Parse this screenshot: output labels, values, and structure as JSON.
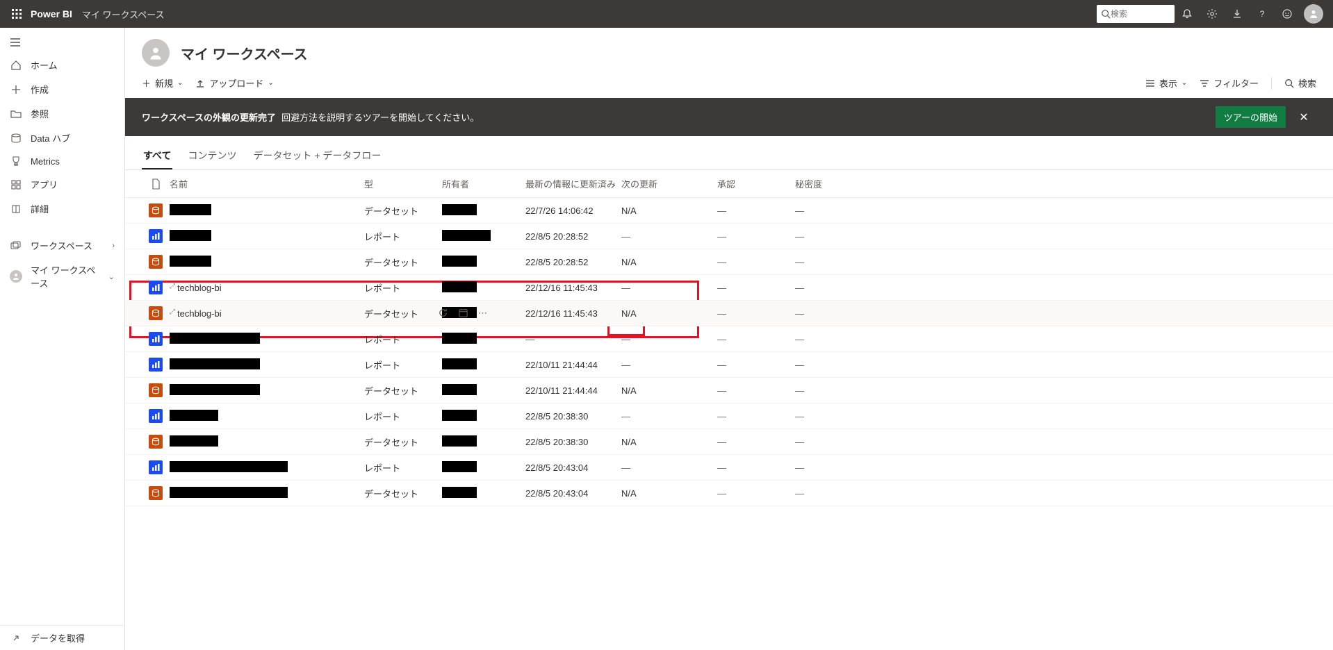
{
  "topbar": {
    "brand": "Power BI",
    "breadcrumb": "マイ ワークスペース",
    "search_placeholder": "検索"
  },
  "sidebar": {
    "home": "ホーム",
    "create": "作成",
    "browse": "参照",
    "datahub": "Data ハブ",
    "metrics": "Metrics",
    "apps": "アプリ",
    "detail": "詳細",
    "workspaces": "ワークスペース",
    "myworkspace": "マイ ワークスペース",
    "getdata": "データを取得"
  },
  "page": {
    "title": "マイ ワークスペース"
  },
  "cmdbar": {
    "new": "新規",
    "upload": "アップロード",
    "view": "表示",
    "filter": "フィルター",
    "search": "検索"
  },
  "banner": {
    "bold": "ワークスペースの外観の更新完了",
    "text": "回避方法を説明するツアーを開始してください。",
    "tour": "ツアーの開始"
  },
  "tabs": {
    "all": "すべて",
    "content": "コンテンツ",
    "dsflow": "データセット + データフロー"
  },
  "cols": {
    "name": "名前",
    "type": "型",
    "owner": "所有者",
    "refreshed": "最新の情報に更新済み",
    "next": "次の更新",
    "approve": "承認",
    "sens": "秘密度"
  },
  "rows": [
    {
      "icon": "dataset",
      "name_redact": 60,
      "type": "データセット",
      "owner_redact": 50,
      "refreshed": "22/7/26 14:06:42",
      "next": "N/A",
      "approve": "—",
      "sens": "—"
    },
    {
      "icon": "report",
      "name_redact": 60,
      "type": "レポート",
      "owner_redact": 70,
      "refreshed": "22/8/5 20:28:52",
      "next": "—",
      "approve": "—",
      "sens": "—"
    },
    {
      "icon": "dataset",
      "name_redact": 60,
      "type": "データセット",
      "owner_redact": 50,
      "refreshed": "22/8/5 20:28:52",
      "next": "N/A",
      "approve": "—",
      "sens": "—"
    },
    {
      "icon": "report",
      "name": "techblog-bi",
      "lineage": true,
      "type": "レポート",
      "owner_redact": 50,
      "refreshed": "22/12/16 11:45:43",
      "next": "—",
      "approve": "—",
      "sens": "—"
    },
    {
      "icon": "dataset",
      "name": "techblog-bi",
      "lineage": true,
      "type": "データセット",
      "owner_redact": 50,
      "refreshed": "22/12/16 11:45:43",
      "next": "N/A",
      "approve": "—",
      "sens": "—",
      "actions": true,
      "hover": true
    },
    {
      "icon": "report",
      "name_redact": 130,
      "type": "レポート",
      "owner_redact": 50,
      "refreshed": "—",
      "next": "—",
      "approve": "—",
      "sens": "—"
    },
    {
      "icon": "report",
      "name_redact": 130,
      "type": "レポート",
      "owner_redact": 50,
      "refreshed": "22/10/11 21:44:44",
      "next": "—",
      "approve": "—",
      "sens": "—"
    },
    {
      "icon": "dataset",
      "name_redact": 130,
      "type": "データセット",
      "owner_redact": 50,
      "refreshed": "22/10/11 21:44:44",
      "next": "N/A",
      "approve": "—",
      "sens": "—"
    },
    {
      "icon": "report",
      "name_redact": 70,
      "type": "レポート",
      "owner_redact": 50,
      "refreshed": "22/8/5 20:38:30",
      "next": "—",
      "approve": "—",
      "sens": "—"
    },
    {
      "icon": "dataset",
      "name_redact": 70,
      "type": "データセット",
      "owner_redact": 50,
      "refreshed": "22/8/5 20:38:30",
      "next": "N/A",
      "approve": "—",
      "sens": "—"
    },
    {
      "icon": "report",
      "name_redact": 170,
      "type": "レポート",
      "owner_redact": 50,
      "refreshed": "22/8/5 20:43:04",
      "next": "—",
      "approve": "—",
      "sens": "—"
    },
    {
      "icon": "dataset",
      "name_redact": 170,
      "type": "データセット",
      "owner_redact": 50,
      "refreshed": "22/8/5 20:43:04",
      "next": "N/A",
      "approve": "—",
      "sens": "—"
    }
  ]
}
